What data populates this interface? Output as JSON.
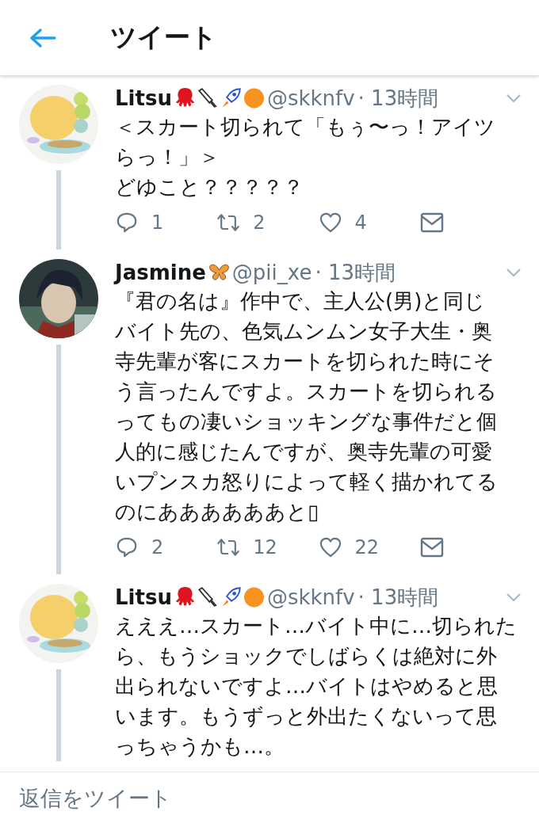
{
  "header": {
    "title": "ツイート"
  },
  "tweets": [
    {
      "name": "Litsu",
      "handle": "@skknfv",
      "time": "· 13時間",
      "lines": [
        "＜スカート切られて「もぅ〜っ！アイツ",
        "らっ！」＞",
        "どゆこと？？？？？"
      ],
      "replies": "1",
      "retweets": "2",
      "likes": "4",
      "thread": true
    },
    {
      "name": "Jasmine",
      "handle": "@pii_xe",
      "time": "· 13時間",
      "lines": [
        "『君の名は』作中で、主人公(男)と同じ",
        "バイト先の、色気ムンムン女子大生・奥",
        "寺先輩が客にスカートを切られた時にそ",
        "う言ったんですよ。スカートを切られる",
        "ってもの凄いショッキングな事件だと個",
        "人的に感じたんですが、奥寺先輩の可愛",
        "いプンスカ怒りによって軽く描かれてる",
        "のにああああああと▯"
      ],
      "replies": "2",
      "retweets": "12",
      "likes": "22",
      "thread": true
    },
    {
      "name": "Litsu",
      "handle": "@skknfv",
      "time": "· 13時間",
      "lines": [
        "えええ…スカート…バイト中に…切られた",
        "ら、もうショックでしばらくは絶対に外",
        "出られないですよ…バイトはやめると思",
        "います。もうずっと外出たくないって思",
        "っちゃうかも…。"
      ],
      "thread": true
    }
  ],
  "reply_bar": {
    "placeholder": "返信をツイート"
  }
}
